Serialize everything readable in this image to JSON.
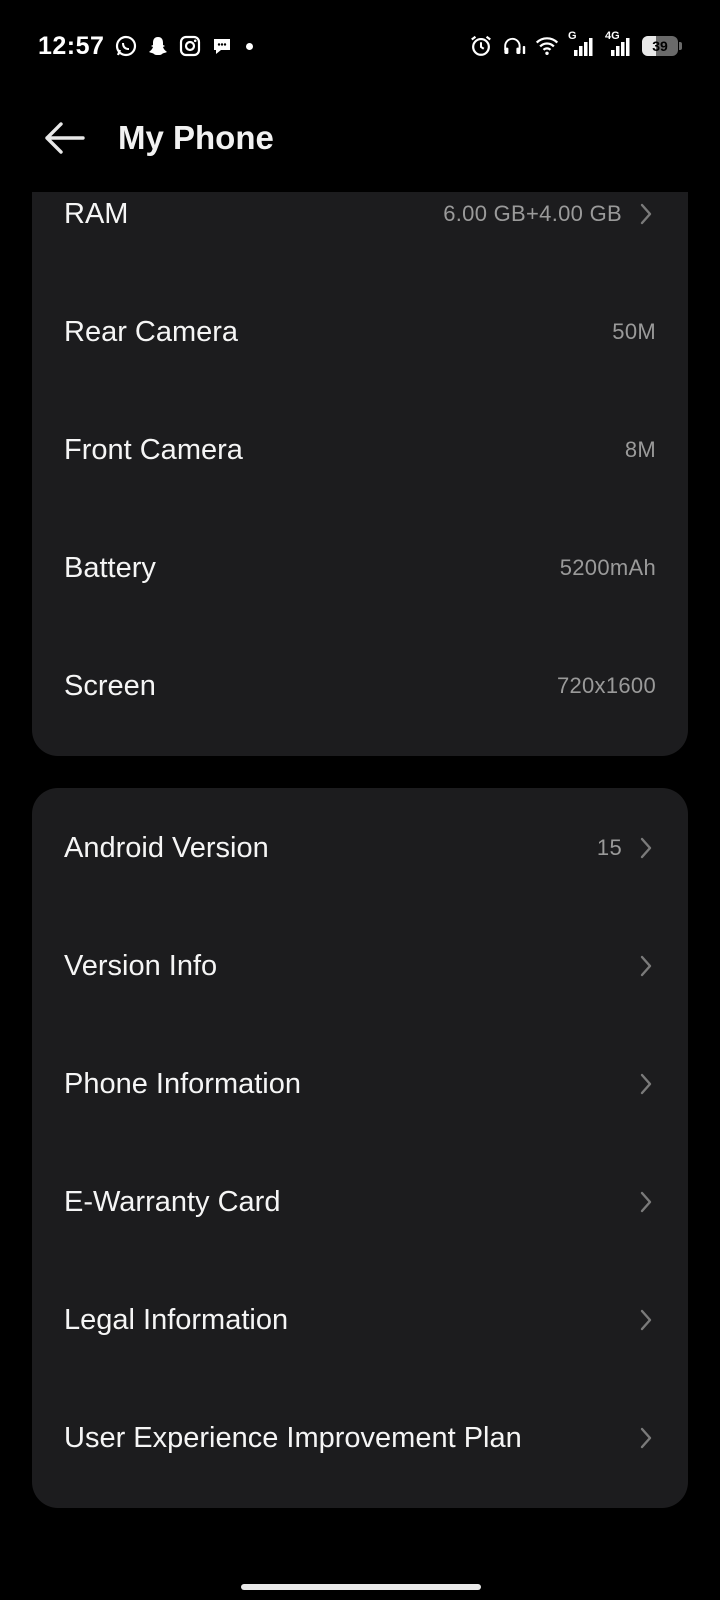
{
  "status_bar": {
    "time": "12:57",
    "notification_icons": [
      "whatsapp-icon",
      "snapchat-icon",
      "instagram-icon",
      "chat-bubble-icon"
    ],
    "signal_1_tag": "G",
    "signal_2_tag": "4G",
    "battery_level": "39",
    "battery_fraction": 0.39
  },
  "header": {
    "title": "My Phone"
  },
  "specs": {
    "ram": {
      "label": "RAM",
      "value": "6.00 GB+4.00 GB"
    },
    "rear_camera": {
      "label": "Rear Camera",
      "value": "50M"
    },
    "front_camera": {
      "label": "Front Camera",
      "value": "8M"
    },
    "battery": {
      "label": "Battery",
      "value": "5200mAh"
    },
    "screen": {
      "label": "Screen",
      "value": "720x1600"
    }
  },
  "info": {
    "android_version": {
      "label": "Android Version",
      "value": "15"
    },
    "version_info": {
      "label": "Version Info"
    },
    "phone_information": {
      "label": "Phone Information"
    },
    "e_warranty_card": {
      "label": "E-Warranty Card"
    },
    "legal_information": {
      "label": "Legal Information"
    },
    "user_experience_plan": {
      "label": "User Experience Improvement Plan"
    }
  },
  "colors": {
    "background": "#000000",
    "card": "#1c1c1e",
    "primary_text": "#f5f5f5",
    "secondary_text": "#9a9a9a",
    "chevron": "#7a7a7a"
  }
}
